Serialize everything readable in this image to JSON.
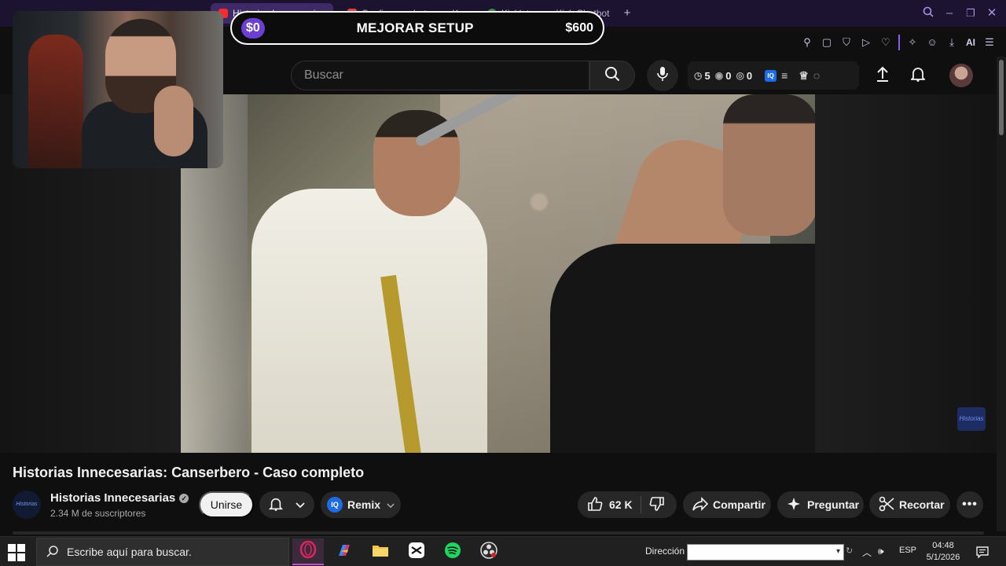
{
  "browser": {
    "tabs": [
      {
        "label": "Historias Innecesarias",
        "active": true
      },
      {
        "label": "Configurar alertas en K",
        "active": false
      },
      {
        "label": "Kicklet.app - Kick Chatbot",
        "active": false
      }
    ],
    "new_tab_label": "+"
  },
  "goal_bar": {
    "start": "$0",
    "title": "MEJORAR SETUP",
    "end": "$600"
  },
  "extensions": {
    "ai_label": "AI"
  },
  "youtube_header": {
    "search_placeholder": "Buscar",
    "stats": {
      "count_a": "5",
      "count_b": "0",
      "count_c": "0"
    }
  },
  "video": {
    "title": "Historias Innecesarias: Canserbero - Caso completo",
    "watermark": "Historias"
  },
  "channel": {
    "name": "Historias Innecesarias",
    "subscribers": "2.34 M de suscriptores",
    "avatar_text": "Historias"
  },
  "actions": {
    "join": "Unirse",
    "remix": "Remix",
    "likes": "62 K",
    "share": "Compartir",
    "ask": "Preguntar",
    "clip": "Recortar",
    "iq": "IQ"
  },
  "taskbar": {
    "search_placeholder": "Escribe aquí para buscar.",
    "address_label": "Dirección",
    "language": "ESP",
    "time": "04:48",
    "date": "5/1/2026"
  },
  "colors": {
    "accent": "#8a5cf5",
    "browser_bg": "#1b1330",
    "yt_bg": "#0f0f0f",
    "pill_bg": "#272727"
  }
}
